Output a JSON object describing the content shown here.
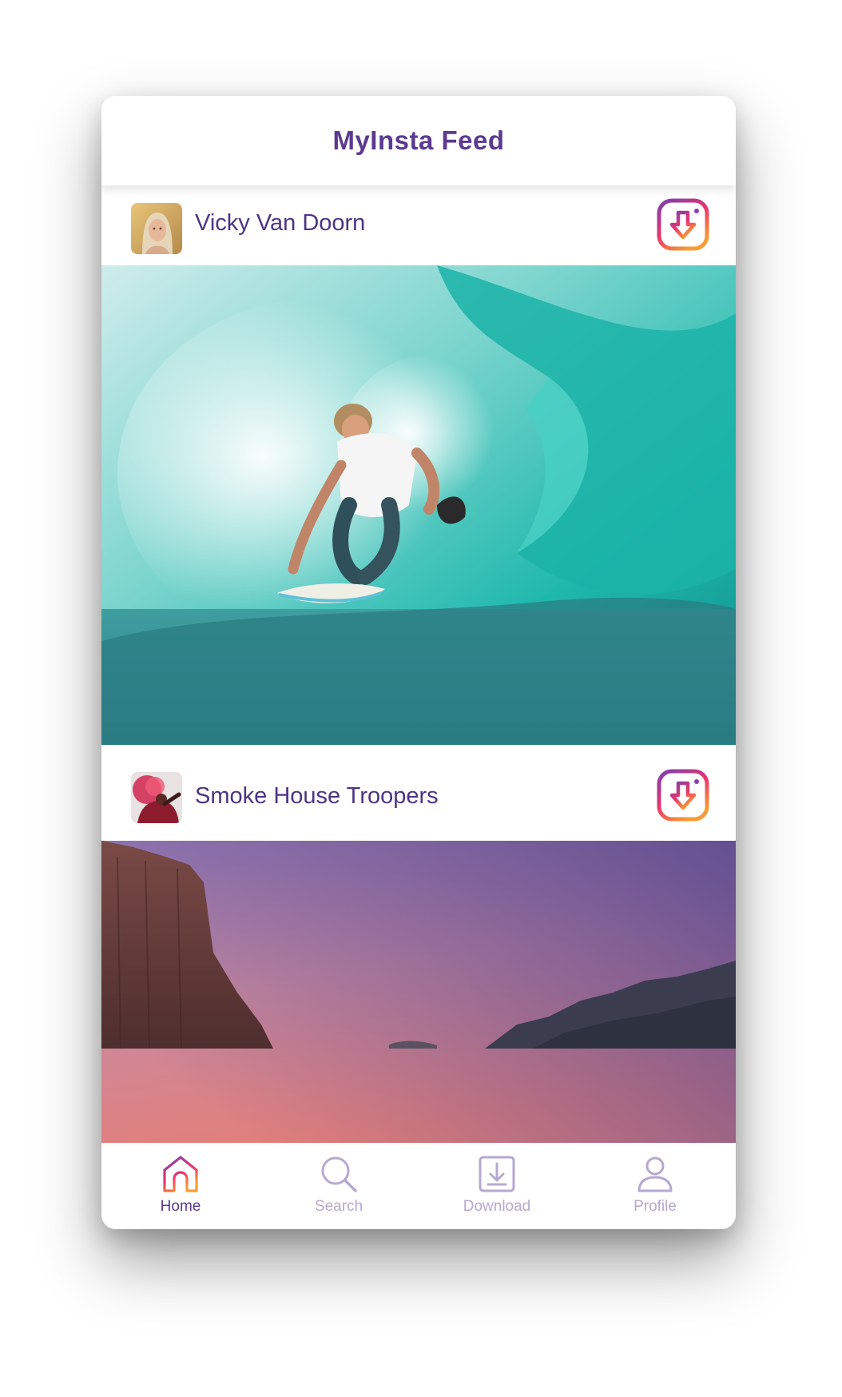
{
  "app": {
    "title": "MyInsta Feed"
  },
  "posts": [
    {
      "username": "Vicky Van Doorn",
      "photo": "surfer riding inside a turquoise wave barrel"
    },
    {
      "username": "Smoke House Troopers",
      "photo": "granite cliffs against a pink-purple dusk sky"
    }
  ],
  "tabs": [
    {
      "label": "Home",
      "icon": "home-icon",
      "active": true
    },
    {
      "label": "Search",
      "icon": "search-icon",
      "active": false
    },
    {
      "label": "Download",
      "icon": "download-icon",
      "active": false
    },
    {
      "label": "Profile",
      "icon": "profile-icon",
      "active": false
    }
  ],
  "colors": {
    "brand": "#5b3a8f",
    "username": "#4d3584",
    "inactive_tab": "#b5a9d0",
    "gradient": [
      "#7b3fb0",
      "#e8366c",
      "#f99b32"
    ]
  }
}
